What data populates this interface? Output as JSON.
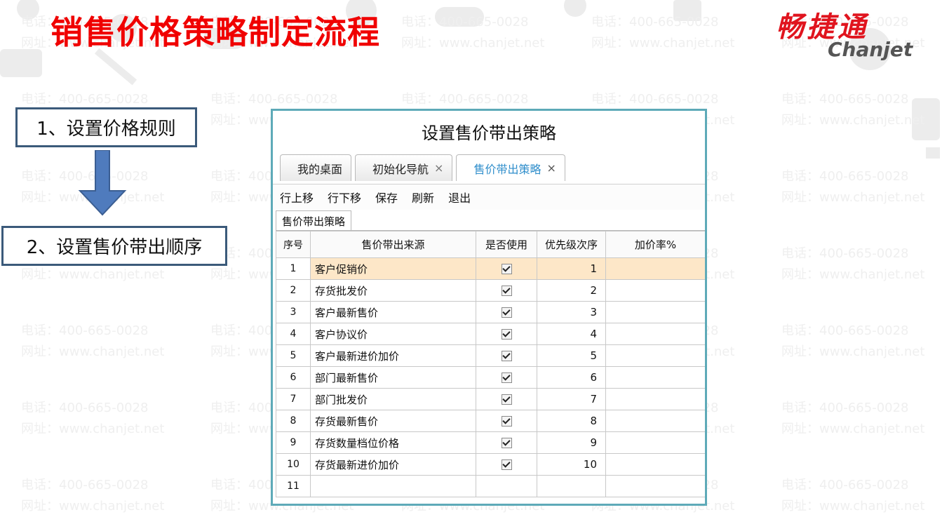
{
  "slide": {
    "title": "销售价格策略制定流程",
    "logo_cn": "畅捷通",
    "logo_en": "Chanjet",
    "watermark_phone": "电话：400-665-0028",
    "watermark_site": "网址：www.chanjet.net"
  },
  "steps": {
    "step1": "1、设置价格规则",
    "step2": "2、设置售价带出顺序"
  },
  "app": {
    "window_title": "设置售价带出策略",
    "tabs": [
      {
        "label": "我的桌面",
        "closable": false
      },
      {
        "label": "初始化导航",
        "closable": true
      },
      {
        "label": "售价带出策略",
        "closable": true,
        "active": true
      }
    ],
    "close_glyph": "×",
    "toolbar": [
      "行上移",
      "行下移",
      "保存",
      "刷新",
      "退出"
    ],
    "subtab": "售价带出策略",
    "columns": [
      "序号",
      "售价带出来源",
      "是否使用",
      "优先级次序",
      "加价率%"
    ],
    "rows": [
      {
        "no": "1",
        "source": "客户促销价",
        "used": true,
        "priority": "1",
        "rate": ""
      },
      {
        "no": "2",
        "source": "存货批发价",
        "used": true,
        "priority": "2",
        "rate": ""
      },
      {
        "no": "3",
        "source": "客户最新售价",
        "used": true,
        "priority": "3",
        "rate": ""
      },
      {
        "no": "4",
        "source": "客户协议价",
        "used": true,
        "priority": "4",
        "rate": ""
      },
      {
        "no": "5",
        "source": "客户最新进价加价",
        "used": true,
        "priority": "5",
        "rate": ""
      },
      {
        "no": "6",
        "source": "部门最新售价",
        "used": true,
        "priority": "6",
        "rate": ""
      },
      {
        "no": "7",
        "source": "部门批发价",
        "used": true,
        "priority": "7",
        "rate": ""
      },
      {
        "no": "8",
        "source": "存货最新售价",
        "used": true,
        "priority": "8",
        "rate": ""
      },
      {
        "no": "9",
        "source": "存货数量档位价格",
        "used": true,
        "priority": "9",
        "rate": ""
      },
      {
        "no": "10",
        "source": "存货最新进价加价",
        "used": true,
        "priority": "10",
        "rate": ""
      },
      {
        "no": "11",
        "source": "",
        "used": false,
        "priority": "",
        "rate": ""
      }
    ],
    "selected_row": 0
  }
}
